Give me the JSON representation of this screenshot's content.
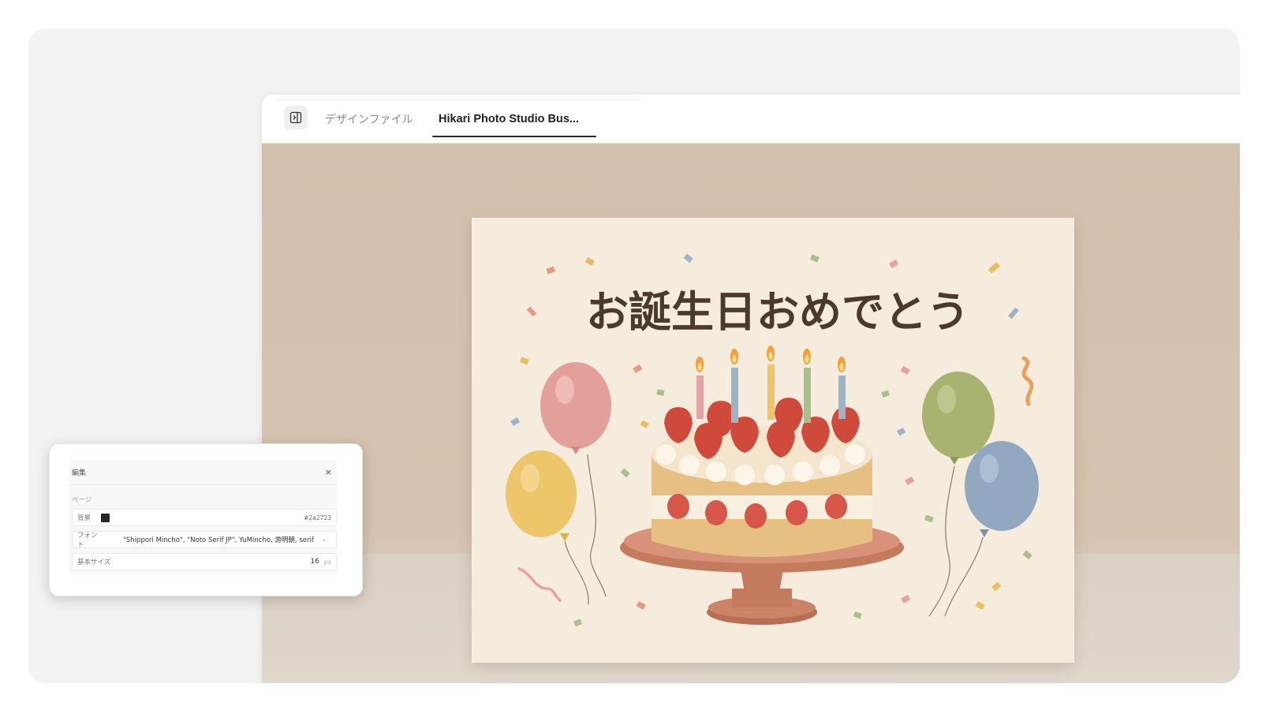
{
  "tabs": [
    {
      "label": "デザインファイル",
      "active": false
    },
    {
      "label": "Hikari Photo Studio Bus...",
      "active": true
    }
  ],
  "card": {
    "greeting": "お誕生日おめでとう",
    "candles": 5
  },
  "edit_panel": {
    "title": "編集",
    "close_label": "×",
    "section": "ページ",
    "background": {
      "label": "背景",
      "value": "#2a2723",
      "color": "#2a2723"
    },
    "font": {
      "label": "フォント",
      "value": "\"Shippori Mincho\", \"Noto Serif JP\", YuMincho, 游明朝, serif"
    },
    "base_size": {
      "label": "基本サイズ",
      "value": "16",
      "unit": "px"
    }
  },
  "icons": [
    "sidebar-toggle-icon",
    "close-icon",
    "chevron-down-icon"
  ],
  "colors": {
    "background_swatch": "#2a2723",
    "studio_backdrop": "#d3c0ad",
    "card_paper": "#f6ecde"
  }
}
